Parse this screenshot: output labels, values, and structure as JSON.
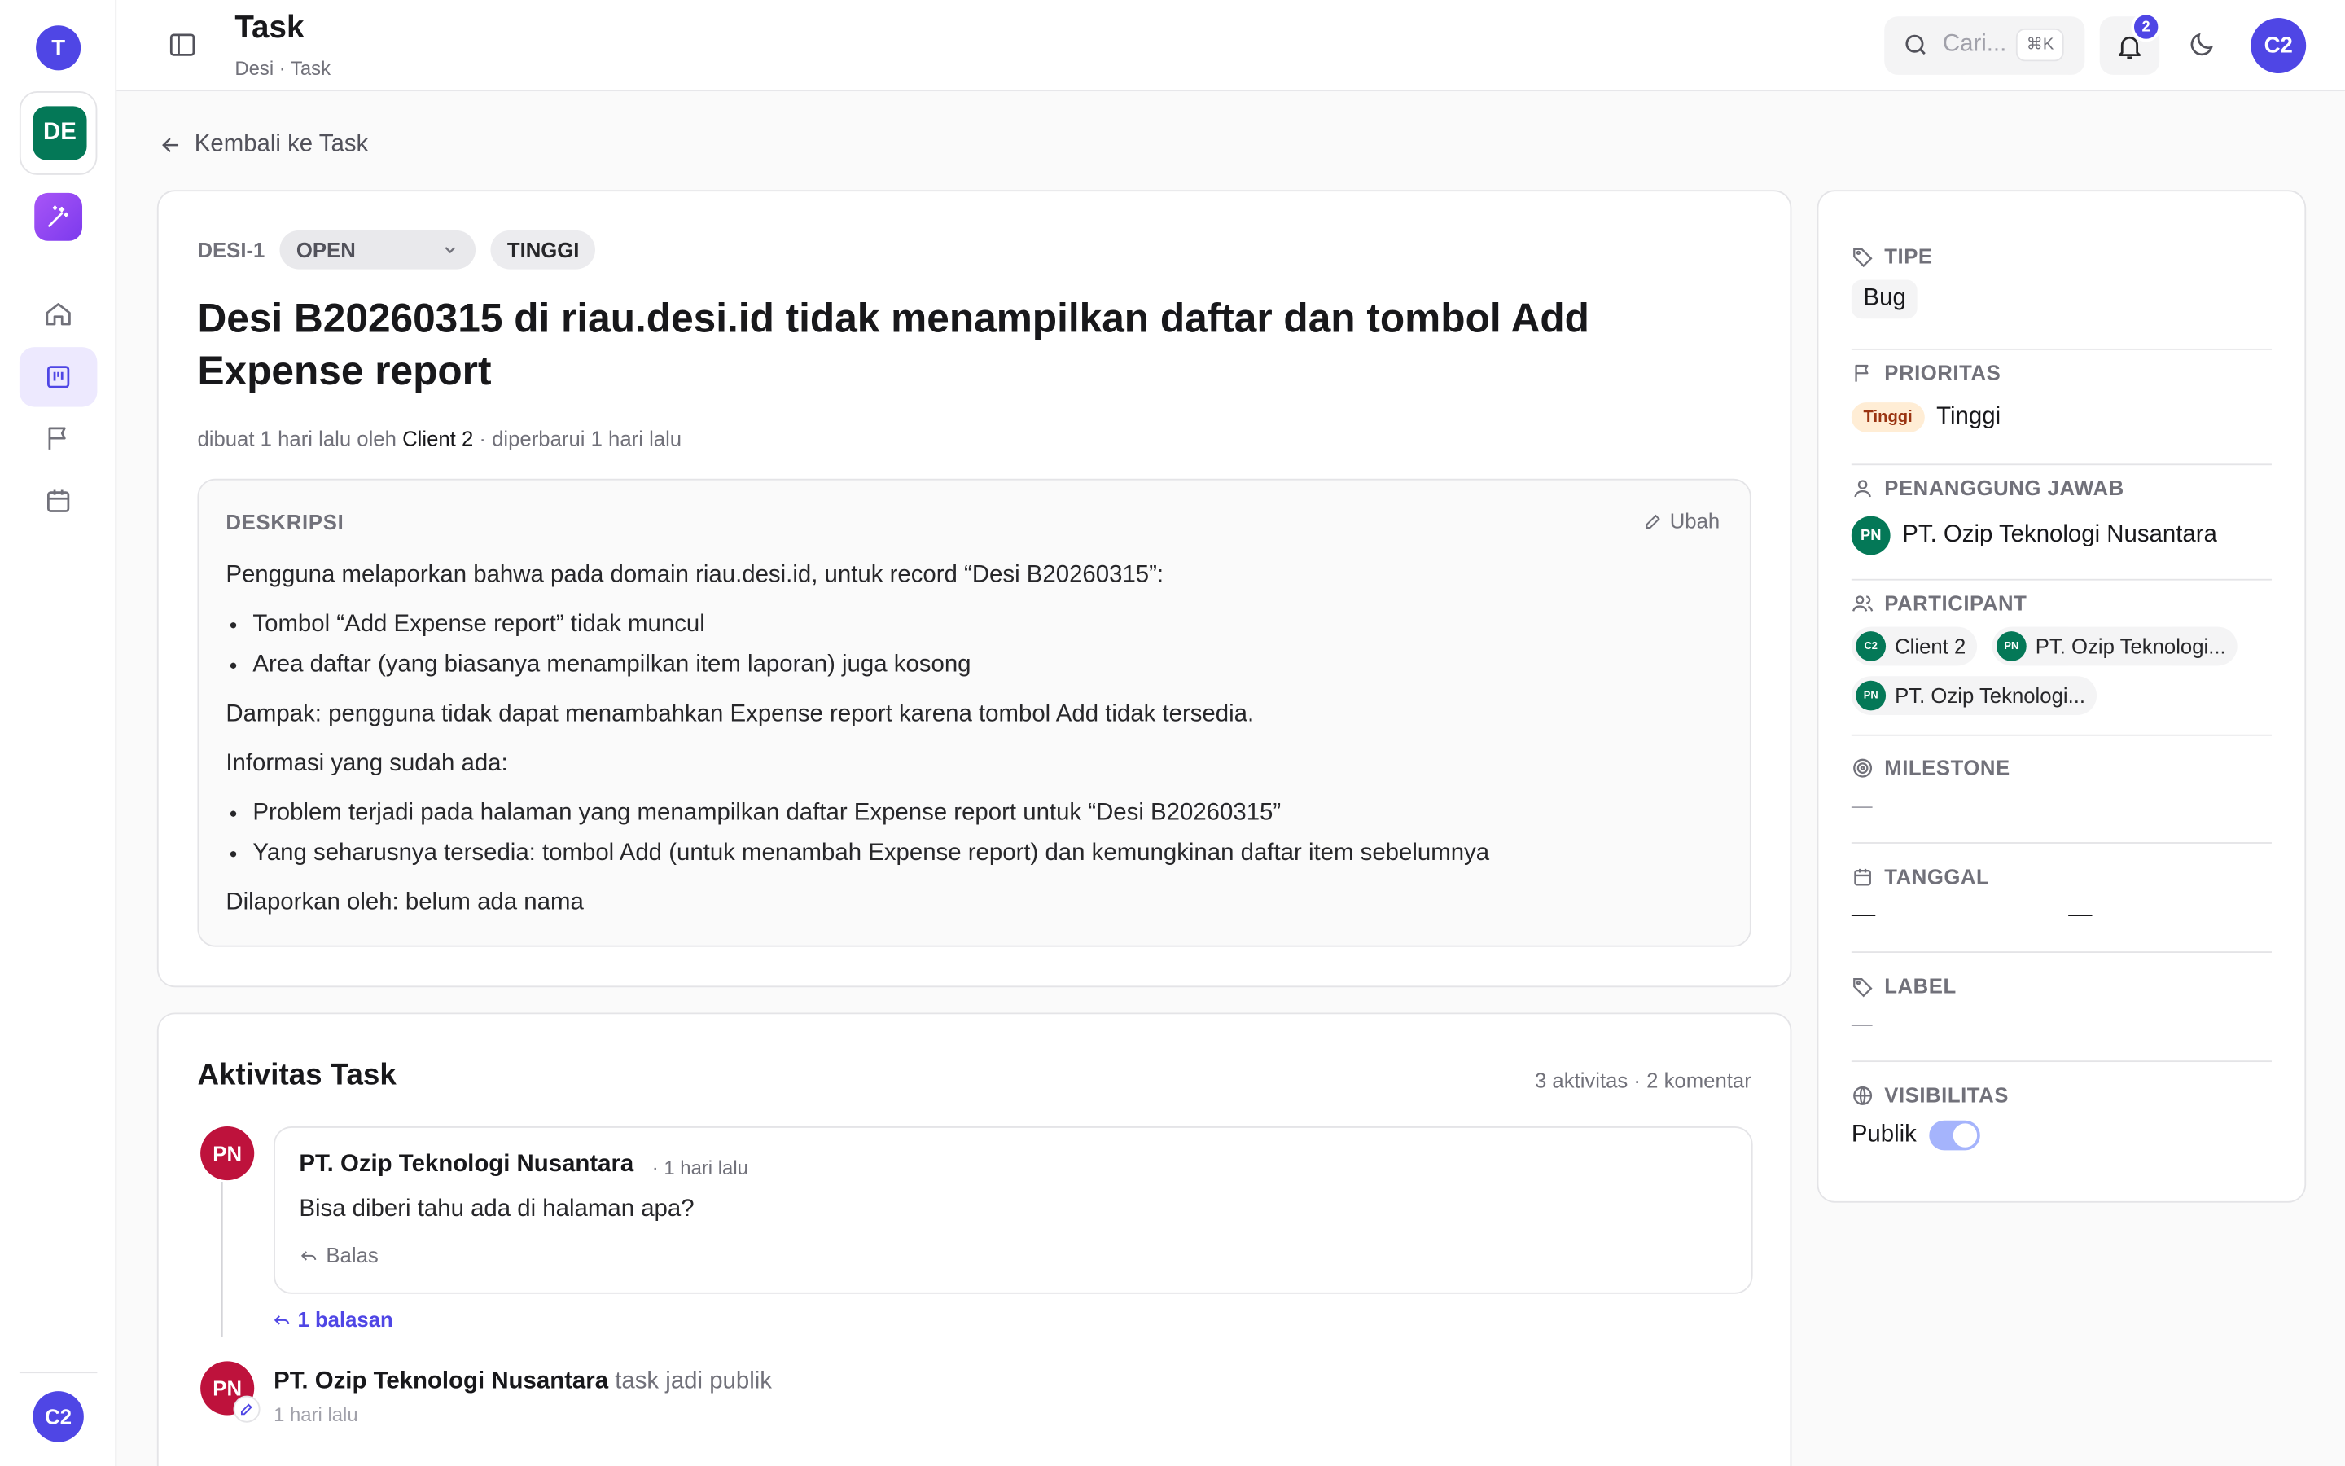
{
  "rail": {
    "workspace_initial": "T",
    "project_initials": "DE",
    "user_initials": "C2"
  },
  "header": {
    "title": "Task",
    "breadcrumb": "Desi · Task",
    "search_placeholder": "Cari...",
    "search_shortcut": "⌘K",
    "notification_count": "2",
    "avatar_initials": "C2"
  },
  "back_link": "Kembali ke Task",
  "task": {
    "key": "DESI-1",
    "status": "OPEN",
    "priority": "TINGGI",
    "title": "Desi B20260315 di riau.desi.id tidak menampilkan daftar dan tombol Add Expense report",
    "meta_created": "dibuat 1 hari lalu oleh",
    "meta_author": "Client 2",
    "meta_updated": "· diperbarui 1 hari lalu",
    "description": {
      "header": "DESKRIPSI",
      "edit_label": "Ubah",
      "intro": "Pengguna melaporkan bahwa pada domain riau.desi.id, untuk record “Desi B20260315”:",
      "bullets_1": [
        "Tombol “Add Expense report” tidak muncul",
        "Area daftar (yang biasanya menampilkan item laporan) juga kosong"
      ],
      "impact": "Dampak: pengguna tidak dapat menambahkan Expense report karena tombol Add tidak tersedia.",
      "info_header": "Informasi yang sudah ada:",
      "bullets_2": [
        "Problem terjadi pada halaman yang menampilkan daftar Expense report untuk “Desi B20260315”",
        "Yang seharusnya tersedia: tombol Add (untuk menambah Expense report) dan kemungkinan daftar item sebelumnya"
      ],
      "reported_by": "Dilaporkan oleh: belum ada nama"
    }
  },
  "activity": {
    "title": "Aktivitas Task",
    "counts": "3 aktivitas · 2 komentar",
    "comment": {
      "avatar": "PN",
      "author": "PT. Ozip Teknologi Nusantara",
      "time": "· 1 hari lalu",
      "text": "Bisa diberi tahu ada di halaman apa?",
      "reply_label": "Balas"
    },
    "replies_label": "1 balasan",
    "event": {
      "avatar": "PN",
      "author": "PT. Ozip Teknologi Nusantara",
      "action": "task jadi publik",
      "time": "1 hari lalu"
    }
  },
  "sidebar": {
    "type_label": "TIPE",
    "type_value": "Bug",
    "priority_label": "PRIORITAS",
    "priority_badge": "Tinggi",
    "priority_value": "Tinggi",
    "assignee_label": "PENANGGUNG JAWAB",
    "assignee_initials": "PN",
    "assignee_name": "PT. Ozip Teknologi Nusantara",
    "participant_label": "PARTICIPANT",
    "participants": [
      {
        "initials": "C2",
        "name": "Client 2"
      },
      {
        "initials": "PN",
        "name": "PT. Ozip Teknologi..."
      },
      {
        "initials": "PN",
        "name": "PT. Ozip Teknologi..."
      }
    ],
    "milestone_label": "MILESTONE",
    "milestone_value": "—",
    "date_label": "TANGGAL",
    "date_start": "—",
    "date_end": "—",
    "label_label": "LABEL",
    "label_value": "—",
    "visibility_label": "VISIBILITAS",
    "visibility_value": "Publik",
    "visibility_on": true
  },
  "colors": {
    "accent": "#4f46e5",
    "project": "#047857",
    "comment_avatar": "#be123c"
  }
}
